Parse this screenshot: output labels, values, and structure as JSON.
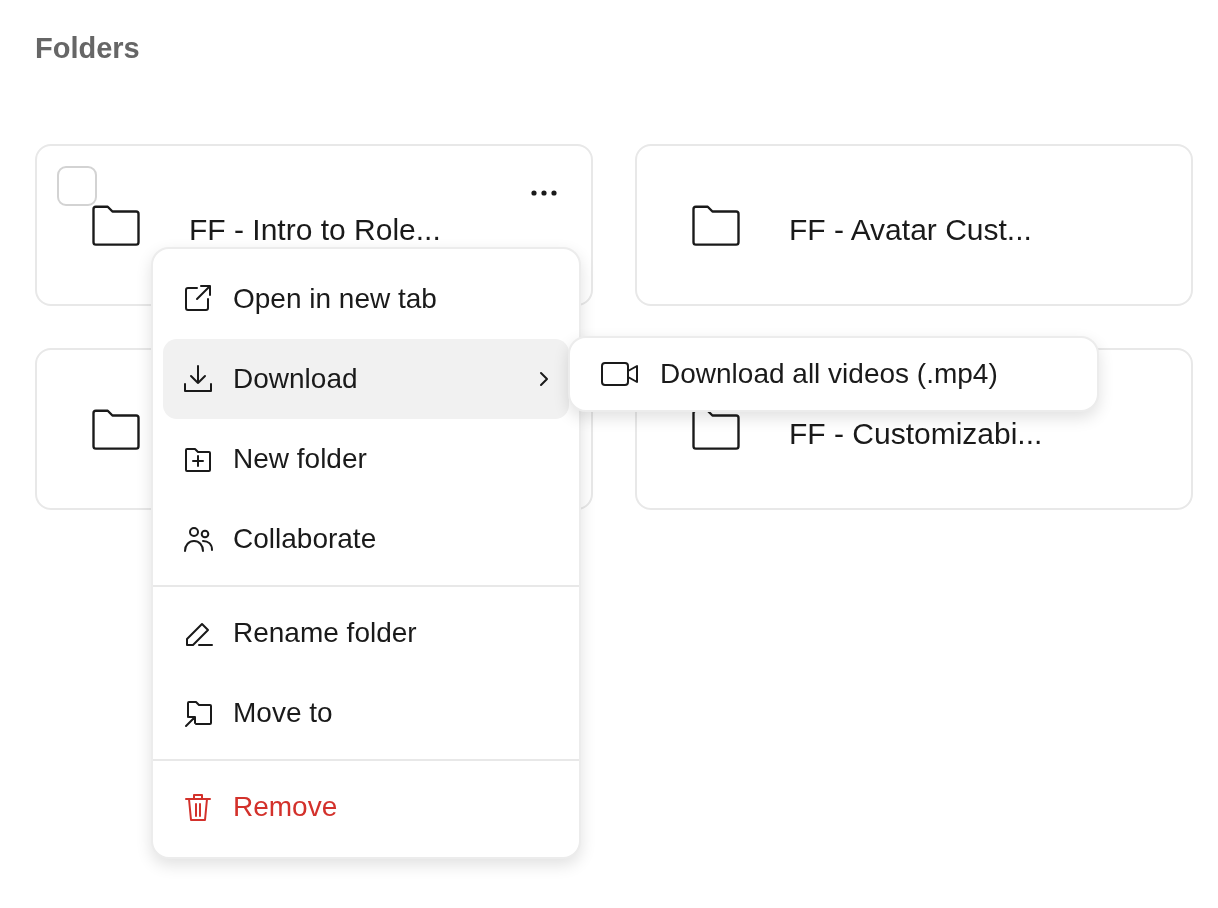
{
  "heading": "Folders",
  "folders": [
    {
      "kind": "folder",
      "name": "FF - Intro to Role...",
      "hovered": true,
      "checkbox": {
        "checked": false
      }
    },
    {
      "kind": "folder",
      "name": "FF - Avatar Cust..."
    },
    {
      "kind": "folder"
    },
    {
      "kind": "folder",
      "name": "FF - Customizabi..."
    }
  ],
  "context_menu": {
    "items": [
      {
        "kind": "item",
        "label": "Open in new tab",
        "selected": false
      },
      {
        "kind": "submenu",
        "label": "Download",
        "selected": true
      },
      {
        "kind": "item",
        "label": "New folder",
        "selected": false
      },
      {
        "kind": "item",
        "label": "Collaborate",
        "selected": false
      },
      {
        "kind": "divider"
      },
      {
        "kind": "item",
        "label": "Rename folder",
        "selected": false
      },
      {
        "kind": "item",
        "label": "Move to",
        "selected": false
      },
      {
        "kind": "divider"
      },
      {
        "kind": "danger",
        "label": "Remove",
        "selected": false
      }
    ]
  },
  "submenu": {
    "items": [
      {
        "label": "Download all videos (.mp4)"
      }
    ]
  }
}
